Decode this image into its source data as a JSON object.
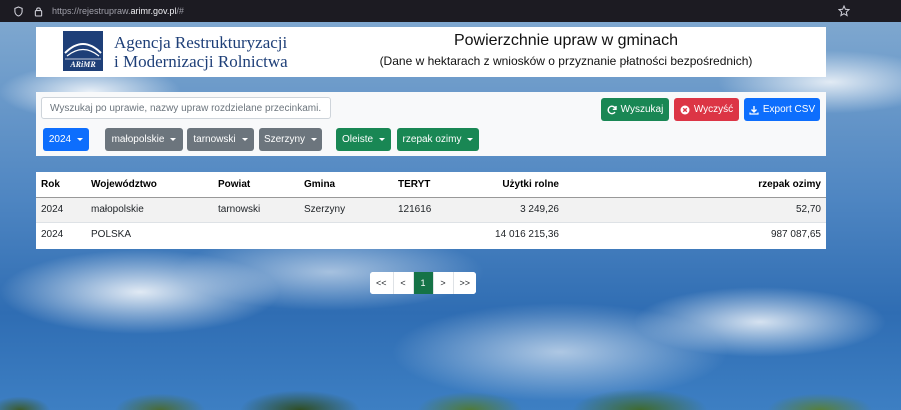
{
  "browser": {
    "url_prefix": "https://rejestrupraw.",
    "url_domain": "arimr.gov.pl",
    "url_suffix": "/#"
  },
  "header": {
    "logo_caption": "ARiMR",
    "org_line1": "Agencja Restrukturyzacji",
    "org_line2": "i Modernizacji Rolnictwa",
    "title": "Powierzchnie upraw w gminach",
    "subtitle": "(Dane w hektarach z wniosków o przyznanie płatności bezpośrednich)"
  },
  "search": {
    "placeholder": "Wyszukaj po uprawie, nazwy upraw rozdzielane przecinkami..."
  },
  "actions": {
    "search_label": "Wyszukaj",
    "clear_label": "Wyczyść",
    "export_label": "Export CSV"
  },
  "filters": {
    "year": "2024",
    "voivodeship": "małopolskie",
    "county": "tarnowski",
    "municipality": "Szerzyny",
    "crop_group": "Oleiste",
    "crop": "rzepak ozimy"
  },
  "colors": {
    "primary": "#0d6efd",
    "success": "#198754",
    "danger": "#dc3545",
    "secondary": "#6c757d",
    "brand": "#1e3f78"
  },
  "table": {
    "columns": [
      "Rok",
      "Województwo",
      "Powiat",
      "Gmina",
      "TERYT",
      "Użytki rolne",
      "rzepak ozimy"
    ],
    "rows": [
      [
        "2024",
        "małopolskie",
        "tarnowski",
        "Szerzyny",
        "121616",
        "3 249,26",
        "52,70"
      ],
      [
        "2024",
        "POLSKA",
        "",
        "",
        "",
        "14 016 215,36",
        "987 087,65"
      ]
    ]
  },
  "pagination": {
    "first": "<<",
    "prev": "<",
    "current": "1",
    "next": ">",
    "last": ">>"
  }
}
